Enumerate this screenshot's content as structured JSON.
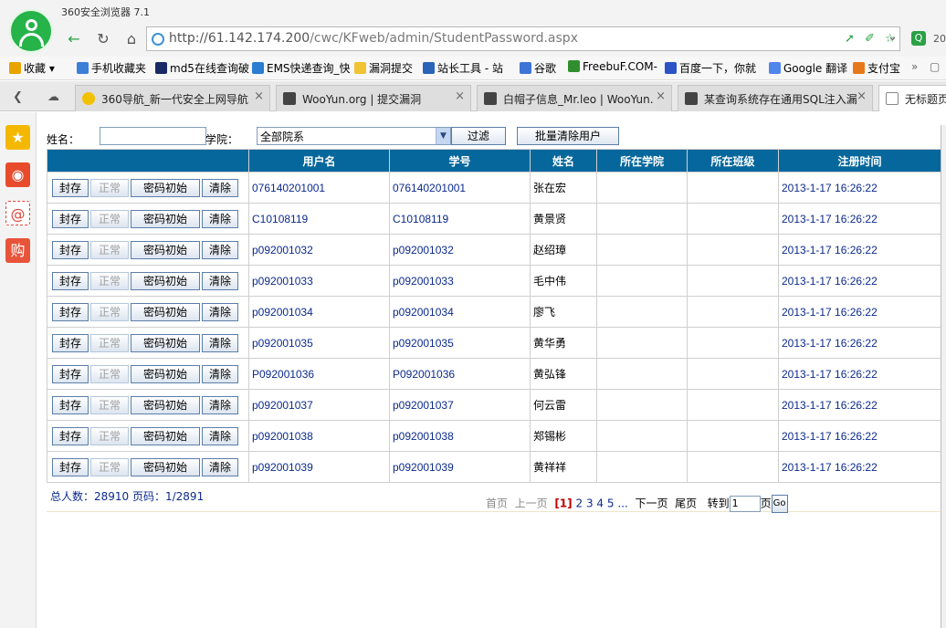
{
  "browser": {
    "app_title": "360安全浏览器 7.1",
    "url_host": "http://61.142.174.200",
    "url_path": "/cwc/KFweb/admin/StudentPassword.aspx",
    "search_hint": "20"
  },
  "bookmarks": [
    {
      "label": "收藏",
      "color": "#e8a300"
    },
    {
      "label": "手机收藏夹",
      "color": "#3b7fd6"
    },
    {
      "label": "md5在线查询破",
      "color": "#1a2a66"
    },
    {
      "label": "EMS快递查询_快",
      "color": "#2a7dd0"
    },
    {
      "label": "漏洞提交",
      "color": "#f1c232"
    },
    {
      "label": "站长工具 - 站",
      "color": "#2a64b8"
    },
    {
      "label": "谷歌",
      "color": "#3d74d6"
    },
    {
      "label": "FreebuF.COM-",
      "color": "#2f8f2f"
    },
    {
      "label": "百度一下，你就",
      "color": "#2c53c6"
    },
    {
      "label": "Google 翻译",
      "color": "#4f86ec"
    },
    {
      "label": "支付宝",
      "color": "#e8791a"
    }
  ],
  "tabs": [
    {
      "label": "360导航_新一代安全上网导航"
    },
    {
      "label": "WooYun.org | 提交漏洞"
    },
    {
      "label": "白帽子信息_Mr.leo | WooYun."
    },
    {
      "label": "某查询系统存在通用SQL注入漏"
    },
    {
      "label": "无标题页"
    }
  ],
  "sidebar": [
    "star-icon",
    "weibo-icon",
    "mail-icon",
    "shopping-icon"
  ],
  "filter": {
    "name_label": "姓名：",
    "college_label": "学院：",
    "college_selected": "全部院系",
    "filter_button": "过滤",
    "batch_clear_button": "批量清除用户"
  },
  "table": {
    "headers": [
      "",
      "用户名",
      "学号",
      "姓名",
      "所在学院",
      "所在班级",
      "注册时间"
    ],
    "row_buttons": [
      "封存",
      "正常",
      "密码初始",
      "清除"
    ],
    "rows": [
      {
        "username": "076140201001",
        "student_id": "076140201001",
        "name": "张在宏",
        "college": "",
        "class": "",
        "registered": "2013-1-17 16:26:22"
      },
      {
        "username": "C10108119",
        "student_id": "C10108119",
        "name": "黄景贤",
        "college": "",
        "class": "",
        "registered": "2013-1-17 16:26:22"
      },
      {
        "username": "p092001032",
        "student_id": "p092001032",
        "name": "赵绍璋",
        "college": "",
        "class": "",
        "registered": "2013-1-17 16:26:22"
      },
      {
        "username": "p092001033",
        "student_id": "p092001033",
        "name": "毛中伟",
        "college": "",
        "class": "",
        "registered": "2013-1-17 16:26:22"
      },
      {
        "username": "p092001034",
        "student_id": "p092001034",
        "name": "廖飞",
        "college": "",
        "class": "",
        "registered": "2013-1-17 16:26:22"
      },
      {
        "username": "p092001035",
        "student_id": "p092001035",
        "name": "黄华勇",
        "college": "",
        "class": "",
        "registered": "2013-1-17 16:26:22"
      },
      {
        "username": "P092001036",
        "student_id": "P092001036",
        "name": "黄弘锋",
        "college": "",
        "class": "",
        "registered": "2013-1-17 16:26:22"
      },
      {
        "username": "p092001037",
        "student_id": "p092001037",
        "name": "何云雷",
        "college": "",
        "class": "",
        "registered": "2013-1-17 16:26:22"
      },
      {
        "username": "p092001038",
        "student_id": "p092001038",
        "name": "郑锡彬",
        "college": "",
        "class": "",
        "registered": "2013-1-17 16:26:22"
      },
      {
        "username": "p092001039",
        "student_id": "p092001039",
        "name": "黄祥祥",
        "college": "",
        "class": "",
        "registered": "2013-1-17 16:26:22"
      }
    ]
  },
  "footer": {
    "total_text": "总人数：28910 页码：1/2891",
    "first": "首页",
    "prev": "上一页",
    "current": "[1]",
    "pages": [
      "2",
      "3",
      "4",
      "5"
    ],
    "ellipsis": "...",
    "next": "下一页",
    "last": "尾页",
    "goto_label": "转到",
    "goto_value": "1",
    "page_unit": "页",
    "go_button": "Go"
  }
}
